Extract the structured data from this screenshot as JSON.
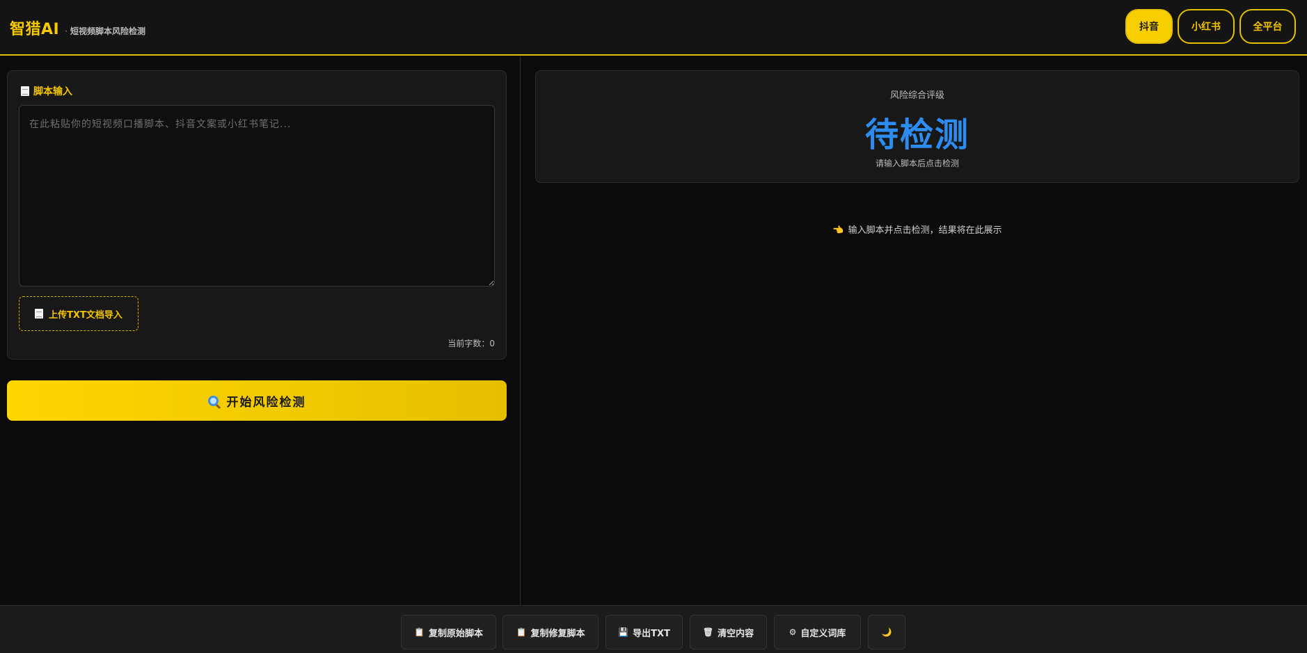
{
  "header": {
    "brand": "智猎AI",
    "separator": "·",
    "subtitle": "短视频脚本风险检测",
    "platforms": [
      {
        "label": "抖音",
        "active": true
      },
      {
        "label": "小红书",
        "active": false
      },
      {
        "label": "全平台",
        "active": false
      }
    ]
  },
  "input_card": {
    "title": "脚本输入",
    "title_icon": "document-icon",
    "textarea_value": "",
    "textarea_placeholder": "在此粘贴你的短视频口播脚本、抖音文案或小红书笔记...",
    "upload_label": "上传TXT文档导入",
    "upload_icon": "document-icon",
    "word_count_label": "当前字数：0"
  },
  "start_button": {
    "label": "开始风险检测",
    "icon": "search-icon"
  },
  "rating": {
    "label": "风险综合评级",
    "value": "待检测",
    "hint": "请输入脚本后点击检测",
    "value_color": "#2d8cf0"
  },
  "empty_state": {
    "icon": "pointing-hand-icon",
    "text": "输入脚本并点击检测，结果将在此展示"
  },
  "toolbar": {
    "buttons": [
      {
        "label": "复制原始脚本",
        "icon": "clipboard-icon"
      },
      {
        "label": "复制修复脚本",
        "icon": "clipboard-icon"
      },
      {
        "label": "导出TXT",
        "icon": "floppy-disk-icon"
      },
      {
        "label": "清空内容",
        "icon": "trash-icon"
      },
      {
        "label": "自定义词库",
        "icon": "gear-icon"
      },
      {
        "label": "",
        "icon": "crescent-moon-icon"
      }
    ]
  },
  "colors": {
    "accent": "#f7c900",
    "background": "#0b0b0b",
    "panel": "#181818",
    "pending_blue": "#2d8cf0"
  }
}
